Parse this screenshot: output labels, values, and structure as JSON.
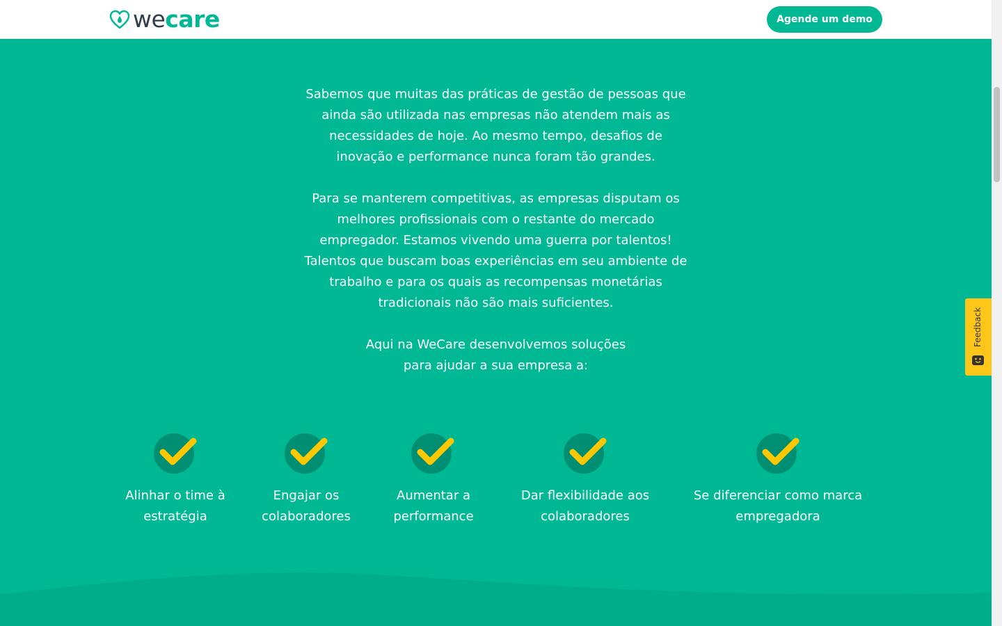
{
  "header": {
    "logo": {
      "we": "we",
      "care": "care",
      "icon": "heart-drop-icon"
    },
    "demo_button": "Agende um demo"
  },
  "intro": {
    "paragraph1": "Sabemos que muitas das práticas de gestão de pessoas que ainda são utilizada nas empresas não atendem mais as necessidades de hoje. Ao mesmo tempo, desafios de inovação e performance nunca foram tão grandes.",
    "paragraph2": "Para se manterem competitivas, as empresas disputam os melhores profissionais com o restante do mercado empregador. Estamos vivendo uma guerra por talentos! Talentos que buscam boas experiências em seu ambiente de trabalho e para os quais as recompensas monetárias tradicionais não são mais suficientes.",
    "paragraph3": "Aqui na WeCare desenvolvemos soluções para ajudar a sua empresa a:"
  },
  "benefits": [
    {
      "icon": "check-icon",
      "label_line1": "Alinhar o time à",
      "label_line2": "estratégia"
    },
    {
      "icon": "check-icon",
      "label_line1": "Engajar os",
      "label_line2": "colaboradores"
    },
    {
      "icon": "check-icon",
      "label_line1": "Aumentar a",
      "label_line2": "performance"
    },
    {
      "icon": "check-icon",
      "label_line1": "Dar flexibilidade aos",
      "label_line2": "colaboradores"
    },
    {
      "icon": "check-icon",
      "label_line1": "Se diferenciar como marca",
      "label_line2": "empregadora"
    }
  ],
  "feedback": {
    "label": "Feedback",
    "icon": "feedback-face-icon"
  },
  "colors": {
    "brand_green": "#00b894",
    "dark_green_circle": "#008f72",
    "check_yellow": "#ffc700",
    "wave_green": "#00ad8a",
    "feedback_yellow": "#ffc61a",
    "logo_dark": "#2f3d4c"
  }
}
